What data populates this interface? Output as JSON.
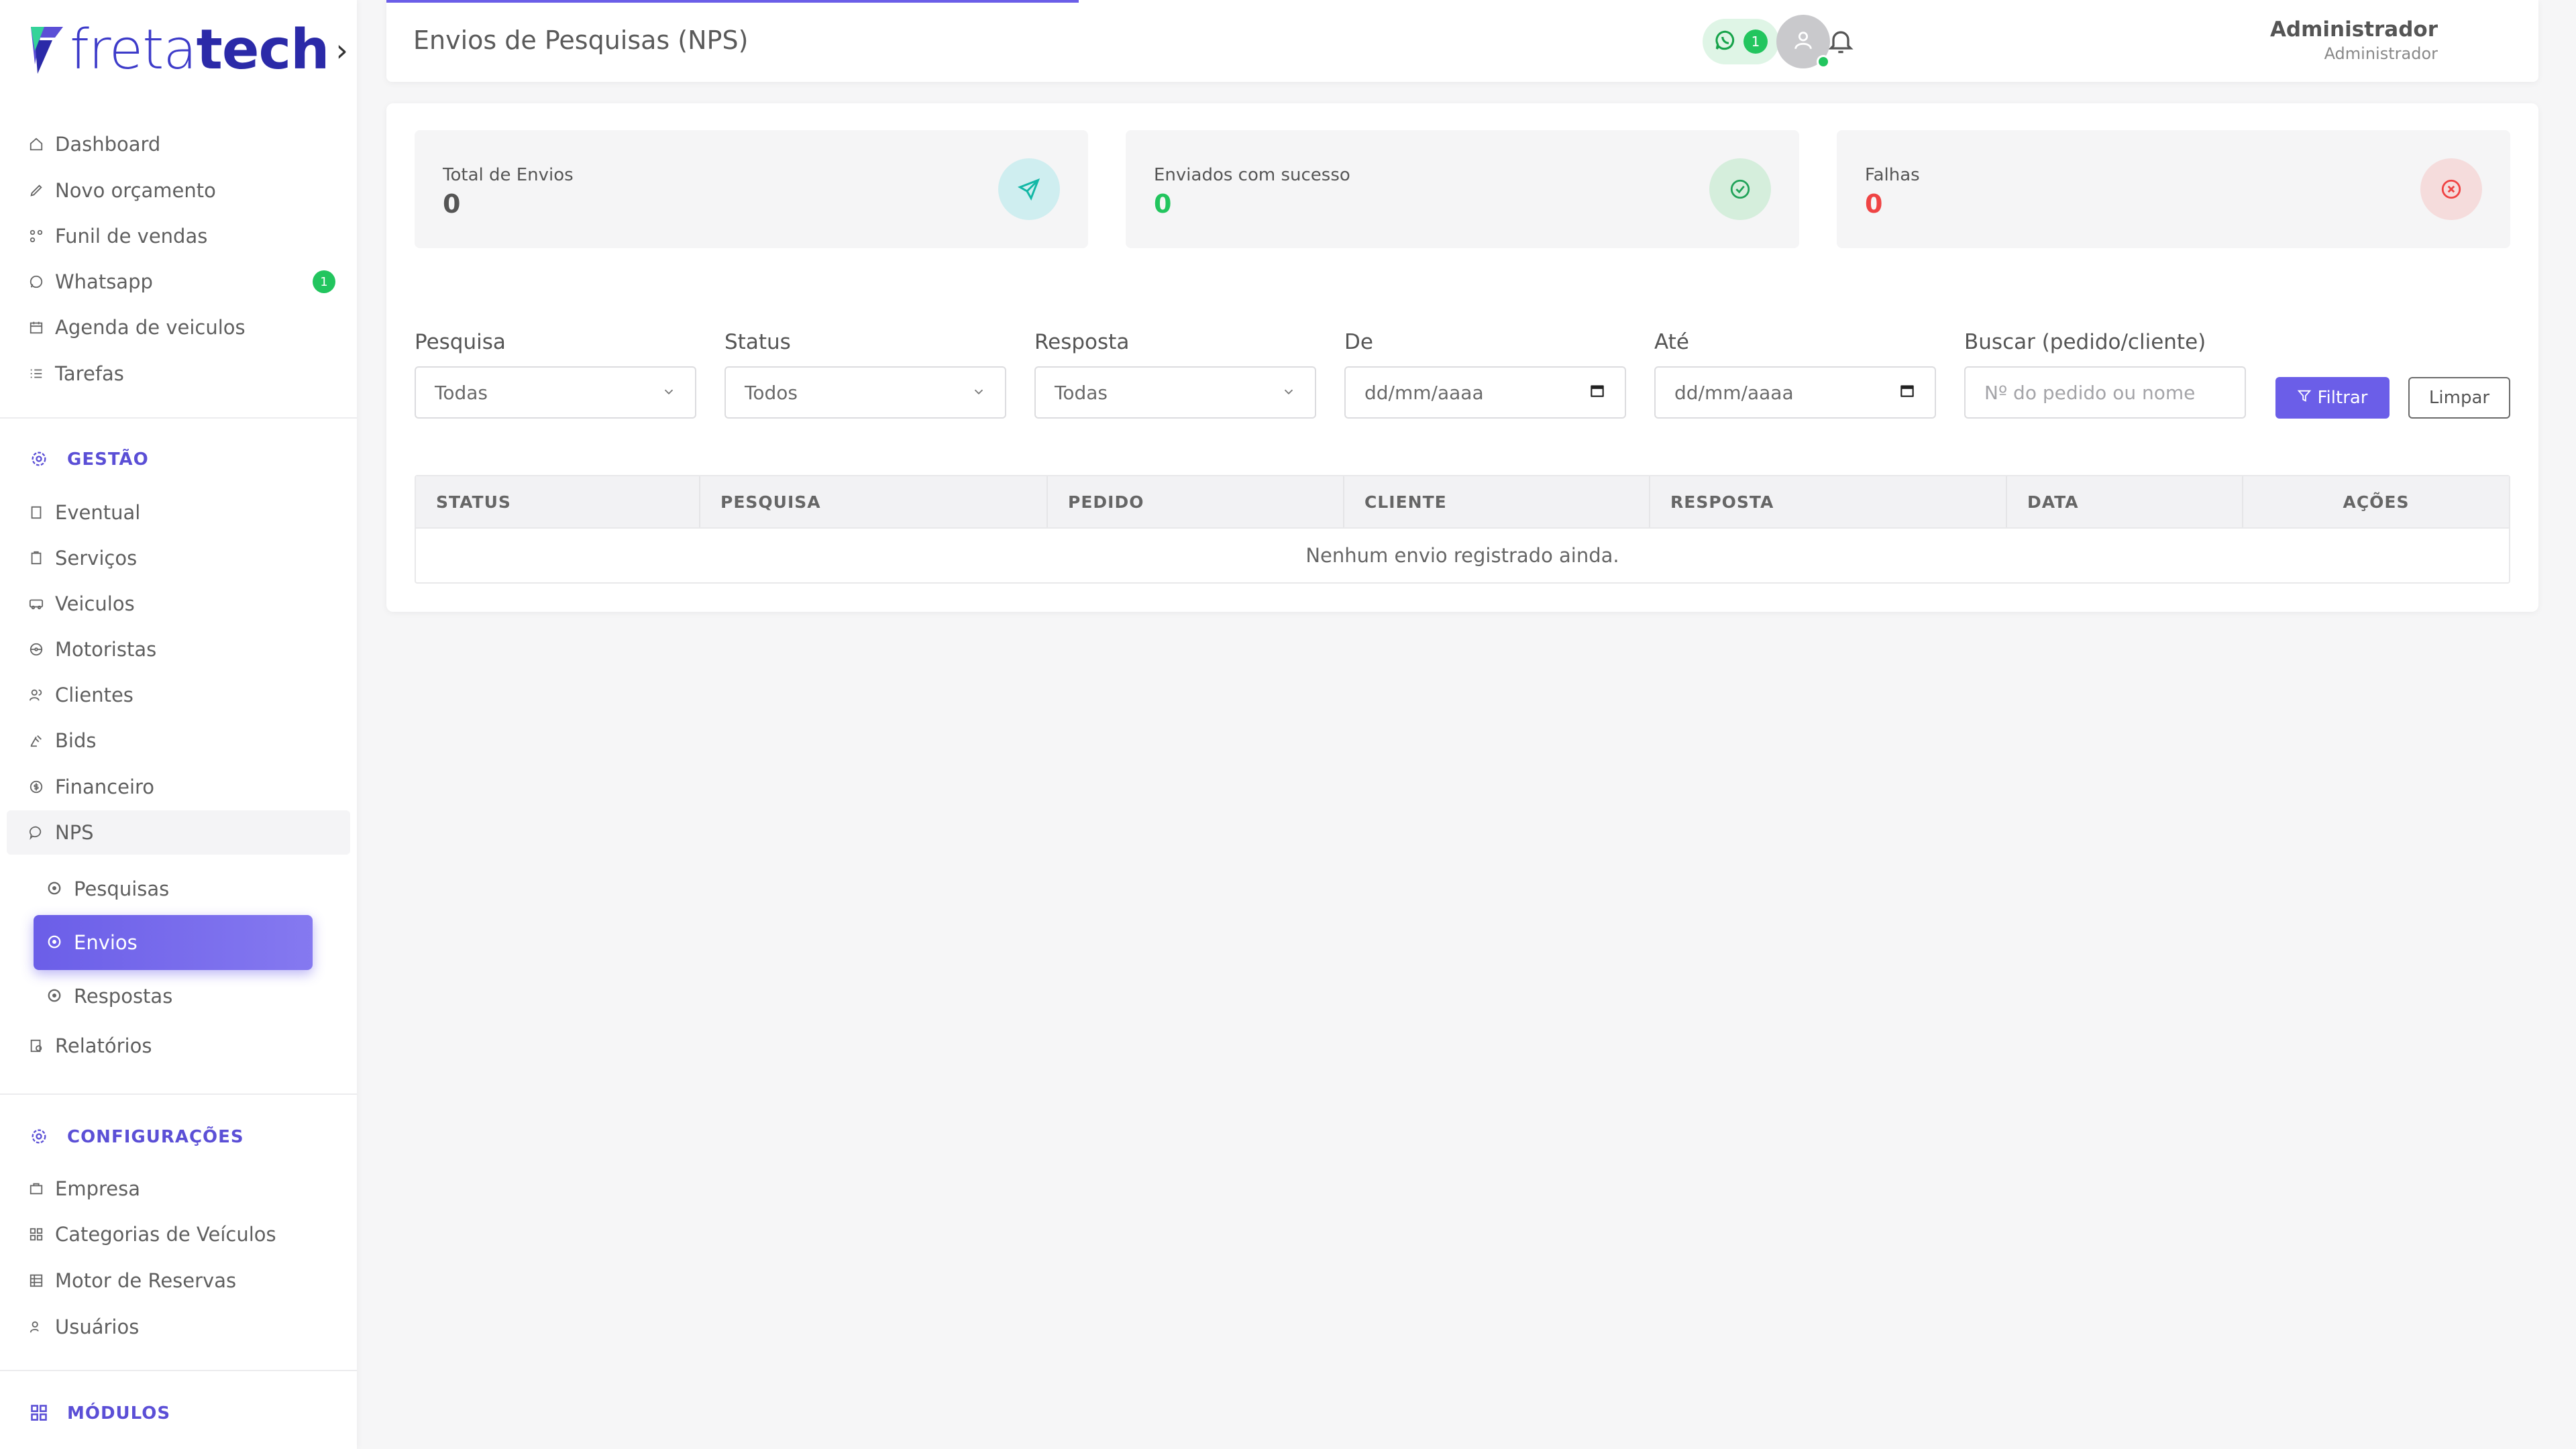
{
  "app": {
    "logo_light": "freta",
    "logo_bold": "tech",
    "accent": "#6b5ee8",
    "success": "#22c55e",
    "danger": "#ef4444"
  },
  "sidebar": {
    "main_items": [
      {
        "label": "Dashboard",
        "icon": "home-icon"
      },
      {
        "label": "Novo orçamento",
        "icon": "edit-icon"
      },
      {
        "label": "Funil de vendas",
        "icon": "funnel-icon"
      },
      {
        "label": "Whatsapp",
        "icon": "whatsapp-icon",
        "badge": "1"
      },
      {
        "label": "Agenda de veiculos",
        "icon": "calendar-icon"
      },
      {
        "label": "Tarefas",
        "icon": "list-icon"
      }
    ],
    "gestao": {
      "title": "GESTÃO",
      "items": [
        "Eventual",
        "Serviços",
        "Veiculos",
        "Motoristas",
        "Clientes",
        "Bids",
        "Financeiro",
        "NPS"
      ],
      "nps_sub": [
        "Pesquisas",
        "Envios",
        "Respostas"
      ],
      "after": "Relatórios"
    },
    "config": {
      "title": "CONFIGURAÇÕES",
      "items": [
        "Empresa",
        "Categorias de Veículos",
        "Motor de Reservas",
        "Usuários"
      ]
    },
    "modules_title": "MÓDULOS"
  },
  "topbar": {
    "title": "Envios de Pesquisas (NPS)",
    "whatsapp_count": "1",
    "user_name": "Administrador",
    "user_role": "Administrador"
  },
  "stats": [
    {
      "label": "Total de Envios",
      "value": "0",
      "icon": "send-icon"
    },
    {
      "label": "Enviados com sucesso",
      "value": "0",
      "icon": "check-circle-icon"
    },
    {
      "label": "Falhas",
      "value": "0",
      "icon": "x-circle-icon"
    }
  ],
  "filters": {
    "pesquisa": {
      "label": "Pesquisa",
      "value": "Todas"
    },
    "status": {
      "label": "Status",
      "value": "Todos"
    },
    "resposta": {
      "label": "Resposta",
      "value": "Todas"
    },
    "de": {
      "label": "De",
      "placeholder": "dd/mm/aaaa"
    },
    "ate": {
      "label": "Até",
      "placeholder": "dd/mm/aaaa"
    },
    "buscar": {
      "label": "Buscar (pedido/cliente)",
      "placeholder": "Nº do pedido ou nome"
    },
    "filter_button": "Filtrar",
    "clear_button": "Limpar"
  },
  "table": {
    "headers": [
      "STATUS",
      "PESQUISA",
      "PEDIDO",
      "CLIENTE",
      "RESPOSTA",
      "DATA",
      "AÇÕES"
    ],
    "empty": "Nenhum envio registrado ainda."
  }
}
